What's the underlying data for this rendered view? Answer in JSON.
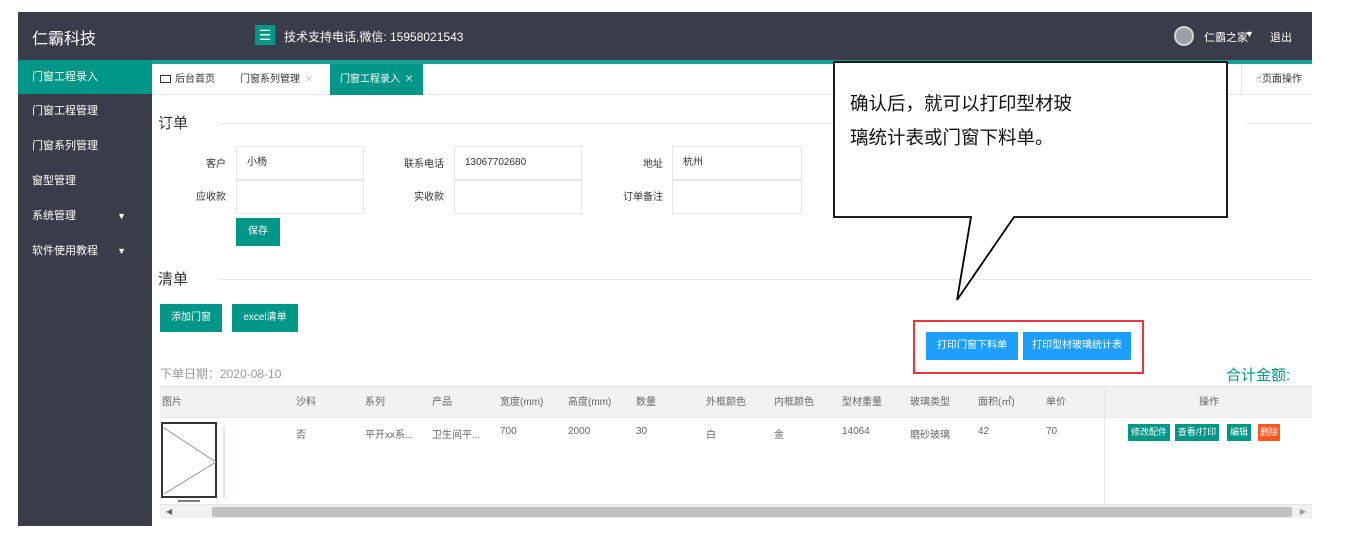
{
  "header": {
    "logo": "仁霸科技",
    "support": "技术支持电话,微信: 15958021543",
    "user_name": "仁霸之家",
    "logout": "退出"
  },
  "sidebar": {
    "items": [
      {
        "label": "门窗工程录入",
        "active": true
      },
      {
        "label": "门窗工程管理"
      },
      {
        "label": "门窗系列管理"
      },
      {
        "label": "窗型管理"
      },
      {
        "label": "系统管理",
        "has_caret": true
      },
      {
        "label": "软件使用教程",
        "has_caret": true
      }
    ]
  },
  "tabs": {
    "items": [
      {
        "label": "后台首页",
        "icon": "monitor-icon"
      },
      {
        "label": "门窗系列管理",
        "closable": true
      },
      {
        "label": "门窗工程录入",
        "closable": true,
        "active": true
      }
    ],
    "page_ops": "页面操作"
  },
  "order": {
    "title": "订单",
    "customer_label": "客户",
    "customer_value": "小杨",
    "phone_label": "联系电话",
    "phone_value": "13067702680",
    "address_label": "地址",
    "address_value": "杭州",
    "receivable_label": "应收款",
    "received_label": "实收款",
    "note_label": "订单备注",
    "save_label": "保存"
  },
  "list": {
    "title": "清单",
    "add_label": "添加门窗",
    "excel_label": "excel清单",
    "print_cutting_label": "打印门窗下料单",
    "print_stats_label": "打印型材玻璃统计表",
    "order_date": "下单日期：2020-08-10",
    "total_label": "合计金额:"
  },
  "table": {
    "columns": [
      "图片",
      "沙料",
      "系列",
      "产品",
      "宽度(mm)",
      "高度(mm)",
      "数量",
      "外框颜色",
      "内框颜色",
      "型材重量",
      "玻璃类型",
      "面积(㎡)",
      "单价",
      "操作"
    ],
    "rows": [
      {
        "screen": "否",
        "series": "平开xx系...",
        "product": "卫生间平...",
        "width": "700",
        "height": "2000",
        "qty": "30",
        "outer_color": "白",
        "inner_color": "金",
        "weight": "14064",
        "glass": "磨砂玻璃",
        "area": "42",
        "price": "70"
      }
    ],
    "actions": [
      "修改配件",
      "查看/打印",
      "编辑",
      "删除"
    ]
  },
  "callout": {
    "line1": "确认后，就可以打印型材玻",
    "line2": "璃统计表或门窗下料单。"
  },
  "colors": {
    "header_bg": "#393d49",
    "accent": "#009688",
    "blue": "#1e9fff",
    "danger": "#ff5722",
    "highlight_border": "#e8363c"
  }
}
